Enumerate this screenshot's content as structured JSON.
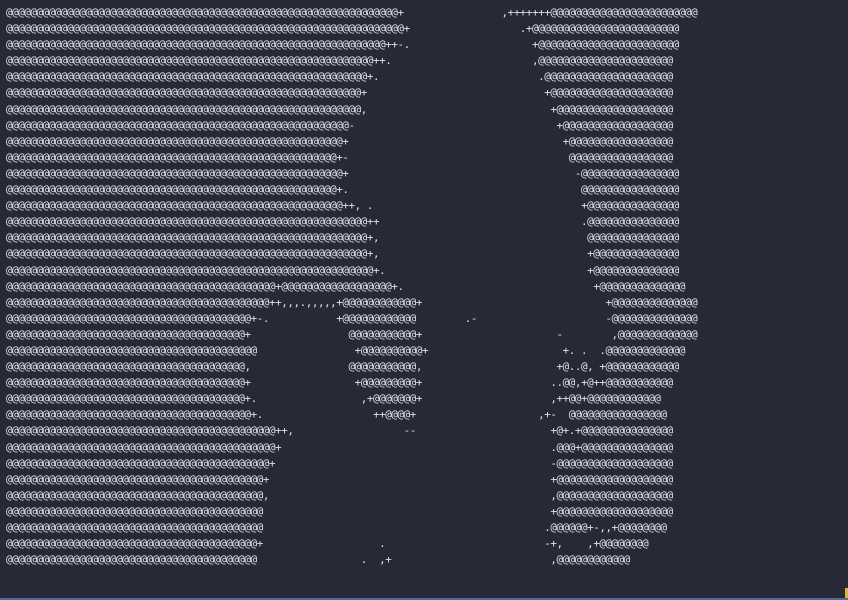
{
  "terminal": {
    "ascii_lines": [
      "@@@@@@@@@@@@@@@@@@@@@@@@@@@@@@@@@@@@@@@@@@@@@@@@@@@@@@@@@@@@@@@@+                ,+++++++@@@@@@@@@@@@@@@@@@@@@@@@",
      "@@@@@@@@@@@@@@@@@@@@@@@@@@@@@@@@@@@@@@@@@@@@@@@@@@@@@@@@@@@@@@@@@+                  .+@@@@@@@@@@@@@@@@@@@@@@@@",
      "@@@@@@@@@@@@@@@@@@@@@@@@@@@@@@@@@@@@@@@@@@@@@@@@@@@@@@@@@@@@@@++-.                    +@@@@@@@@@@@@@@@@@@@@@@@",
      "@@@@@@@@@@@@@@@@@@@@@@@@@@@@@@@@@@@@@@@@@@@@@@@@@@@@@@@@@@@@++.                       ,@@@@@@@@@@@@@@@@@@@@@@",
      "@@@@@@@@@@@@@@@@@@@@@@@@@@@@@@@@@@@@@@@@@@@@@@@@@@@@@@@@@@@+.                          .@@@@@@@@@@@@@@@@@@@@@",
      "@@@@@@@@@@@@@@@@@@@@@@@@@@@@@@@@@@@@@@@@@@@@@@@@@@@@@@@@@@+                             +@@@@@@@@@@@@@@@@@@@@",
      "@@@@@@@@@@@@@@@@@@@@@@@@@@@@@@@@@@@@@@@@@@@@@@@@@@@@@@@@@@,                              +@@@@@@@@@@@@@@@@@@@",
      "@@@@@@@@@@@@@@@@@@@@@@@@@@@@@@@@@@@@@@@@@@@@@@@@@@@@@@@@-                                 +@@@@@@@@@@@@@@@@@@",
      "@@@@@@@@@@@@@@@@@@@@@@@@@@@@@@@@@@@@@@@@@@@@@@@@@@@@@@@+                                   +@@@@@@@@@@@@@@@@@",
      "@@@@@@@@@@@@@@@@@@@@@@@@@@@@@@@@@@@@@@@@@@@@@@@@@@@@@@+-                                    @@@@@@@@@@@@@@@@@",
      "@@@@@@@@@@@@@@@@@@@@@@@@@@@@@@@@@@@@@@@@@@@@@@@@@@@@@@@+                                     -@@@@@@@@@@@@@@@@",
      "@@@@@@@@@@@@@@@@@@@@@@@@@@@@@@@@@@@@@@@@@@@@@@@@@@@@@@+.                                      @@@@@@@@@@@@@@@@",
      "@@@@@@@@@@@@@@@@@@@@@@@@@@@@@@@@@@@@@@@@@@@@@@@@@@@@@@@++, .                                  +@@@@@@@@@@@@@@@",
      "@@@@@@@@@@@@@@@@@@@@@@@@@@@@@@@@@@@@@@@@@@@@@@@@@@@@@@@@@@@++                                 .@@@@@@@@@@@@@@@",
      "@@@@@@@@@@@@@@@@@@@@@@@@@@@@@@@@@@@@@@@@@@@@@@@@@@@@@@@@@@@+,                                  @@@@@@@@@@@@@@@",
      "@@@@@@@@@@@@@@@@@@@@@@@@@@@@@@@@@@@@@@@@@@@@@@@@@@@@@@@@@@@+,                                  +@@@@@@@@@@@@@@",
      "@@@@@@@@@@@@@@@@@@@@@@@@@@@@@@@@@@@@@@@@@@@@@@@@@@@@@@@@@@@@+.                                 +@@@@@@@@@@@@@@",
      "@@@@@@@@@@@@@@@@@@@@@@@@@@@@@@@@@@@@@@@@@@@@+@@@@@@@@@@@@@@@@@@+.                               +@@@@@@@@@@@@@@",
      "@@@@@@@@@@@@@@@@@@@@@@@@@@@@@@@@@@@@@@@@@@@++,,,.,,,,,+@@@@@@@@@@@@+                              +@@@@@@@@@@@@@@",
      "@@@@@@@@@@@@@@@@@@@@@@@@@@@@@@@@@@@@@@@@+-.           +@@@@@@@@@@@@        .-                     -@@@@@@@@@@@@@@",
      "@@@@@@@@@@@@@@@@@@@@@@@@@@@@@@@@@@@@@@@+                @@@@@@@@@@@+                      -        ,@@@@@@@@@@@@@",
      "@@@@@@@@@@@@@@@@@@@@@@@@@@@@@@@@@@@@@@@@@                +@@@@@@@@@@+                      +. .  .@@@@@@@@@@@@@",
      "@@@@@@@@@@@@@@@@@@@@@@@@@@@@@@@@@@@@@@@,                @@@@@@@@@@@,                      +@..@, +@@@@@@@@@@@@",
      "@@@@@@@@@@@@@@@@@@@@@@@@@@@@@@@@@@@@@@@+                 +@@@@@@@@@+                     ..@@,+@++@@@@@@@@@@@",
      "@@@@@@@@@@@@@@@@@@@@@@@@@@@@@@@@@@@@@@@+.                 ,+@@@@@@@+                     ,++@@+@@@@@@@@@@@@",
      "@@@@@@@@@@@@@@@@@@@@@@@@@@@@@@@@@@@@@@@@+.                  ++@@@@+                    ,+-  @@@@@@@@@@@@@@@@",
      "@@@@@@@@@@@@@@@@@@@@@@@@@@@@@@@@@@@@@@@@@@@@++,                  --                      +@+.+@@@@@@@@@@@@@@@",
      "@@@@@@@@@@@@@@@@@@@@@@@@@@@@@@@@@@@@@@@@@@@@+                                            .@@@+@@@@@@@@@@@@@@@",
      "@@@@@@@@@@@@@@@@@@@@@@@@@@@@@@@@@@@@@@@@@@@+                                             -@@@@@@@@@@@@@@@@@@@",
      "@@@@@@@@@@@@@@@@@@@@@@@@@@@@@@@@@@@@@@@@@@+                                              +@@@@@@@@@@@@@@@@@@@",
      "@@@@@@@@@@@@@@@@@@@@@@@@@@@@@@@@@@@@@@@@@@,                                              ,@@@@@@@@@@@@@@@@@@@",
      "@@@@@@@@@@@@@@@@@@@@@@@@@@@@@@@@@@@@@@@@@@                                               +@@@@@@@@@@@@@@@@@@@",
      "@@@@@@@@@@@@@@@@@@@@@@@@@@@@@@@@@@@@@@@@@@                                              .@@@@@@+-,,+@@@@@@@@",
      "@@@@@@@@@@@@@@@@@@@@@@@@@@@@@@@@@@@@@@@@@+                   .                          -+,    ,+@@@@@@@@",
      "@@@@@@@@@@@@@@@@@@@@@@@@@@@@@@@@@@@@@@@@@                 .  ,+                          ,@@@@@@@@@@@@"
    ]
  }
}
